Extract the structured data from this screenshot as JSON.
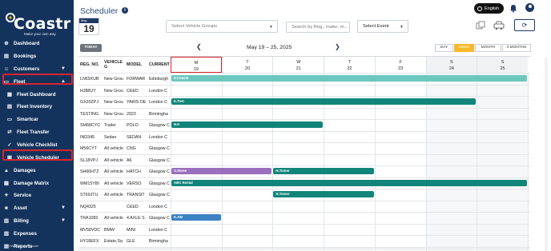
{
  "app": {
    "logo": "Coastr",
    "tagline": "Make your own way",
    "page_title": "Scheduler",
    "powered_by": "POWERED BY Coastr"
  },
  "header": {
    "language": "English"
  },
  "sidebar": {
    "items": [
      {
        "label": "Dashboard",
        "icon": "dashboard-icon"
      },
      {
        "label": "Bookings",
        "icon": "bookings-icon"
      },
      {
        "label": "Customers",
        "icon": "customers-icon",
        "chevron": "down"
      },
      {
        "label": "Fleet",
        "icon": "fleet-icon",
        "chevron": "up"
      },
      {
        "label": "Fleet Dashboard",
        "icon": "fleet-dashboard-icon"
      },
      {
        "label": "Fleet Inventory",
        "icon": "fleet-inventory-icon"
      },
      {
        "label": "Smartcar",
        "icon": "smartcar-icon"
      },
      {
        "label": "Fleet Transfer",
        "icon": "fleet-transfer-icon"
      },
      {
        "label": "Vehicle Checklist",
        "icon": "checklist-icon"
      },
      {
        "label": "Vehicle Scheduler",
        "icon": "scheduler-icon"
      },
      {
        "label": "Damages",
        "icon": "damages-icon"
      },
      {
        "label": "Damage Matrix",
        "icon": "damage-matrix-icon"
      },
      {
        "label": "Service",
        "icon": "service-icon"
      },
      {
        "label": "Asset",
        "icon": "asset-icon",
        "chevron": "down"
      },
      {
        "label": "Billing",
        "icon": "billing-icon",
        "chevron": "down"
      },
      {
        "label": "Expenses",
        "icon": "expenses-icon"
      },
      {
        "label": "Reports",
        "icon": "reports-icon"
      }
    ]
  },
  "toolbar": {
    "date_month": "May",
    "date_day": "19",
    "vehicle_groups_placeholder": "Select Vehicle Groups",
    "search_placeholder": "Search by Reg., make, m...",
    "event_select": "Select Event"
  },
  "calendar": {
    "today_label": "TODAY",
    "range": "May 19 – 25, 2025",
    "views": [
      "DAY",
      "WEEK",
      "MONTH",
      "3 MONTHS"
    ],
    "active_view": "WEEK",
    "days": [
      {
        "dow": "M",
        "date": "19"
      },
      {
        "dow": "T",
        "date": "20"
      },
      {
        "dow": "W",
        "date": "21"
      },
      {
        "dow": "T",
        "date": "22"
      },
      {
        "dow": "F",
        "date": "23"
      },
      {
        "dow": "S",
        "date": "24"
      },
      {
        "dow": "S",
        "date": "25"
      }
    ]
  },
  "table": {
    "columns": [
      "REG. NO.",
      "VEHICLE G",
      "MODEL",
      "CURRENT"
    ],
    "rows": [
      [
        "LN69XUB",
        "New Grou",
        "FORWAR",
        "Edinburgh"
      ],
      [
        "HJ88UY",
        "New Grou",
        "CEED",
        "London C"
      ],
      [
        "GX20ZPJ",
        "New Grou",
        "YARIS DE",
        "London C"
      ],
      [
        "TESTING",
        "New Grou",
        "2023",
        "Birmingha"
      ],
      [
        "SM68CYC",
        "Trailer",
        "POLO",
        "Glasgow C"
      ],
      [
        "IND345",
        "Sedan",
        "SEDAN",
        "London C"
      ],
      [
        "M56CYT",
        "All vehicle",
        "CNG",
        "Glasgow C"
      ],
      [
        "SL18VPJ",
        "All vehicle",
        "A6",
        "Glasgow C"
      ],
      [
        "SH60HTZ",
        "All vehicle",
        "HATCH",
        "Glasgow C"
      ],
      [
        "WM15YBI",
        "All vehicle",
        "VERSO",
        "Glasgow C"
      ],
      [
        "ST69JTU",
        "All vehicle",
        "TRANSIT",
        "Glasgow C"
      ],
      [
        "NQ4325",
        "",
        "CEED",
        "London C"
      ],
      [
        "TRA1082",
        "All vehicle",
        "4 AXLE S",
        "Glasgow C"
      ],
      [
        "MV58VDC",
        "BMW",
        "MINI",
        "London C"
      ],
      [
        "HY18EFX",
        "Estate,Sq",
        "GLE",
        "Birmingha"
      ],
      [
        "FK12ABC",
        "New Grou",
        "SEDAN",
        "Glasgow C"
      ]
    ]
  },
  "events": [
    {
      "row": 0,
      "label": "E.Coasts",
      "color": "#6cc7bf",
      "start": 0,
      "end": 7
    },
    {
      "row": 2,
      "label": "K.Test",
      "color": "#12857a",
      "start": 0,
      "end": 6
    },
    {
      "row": 4,
      "label": "N.K",
      "color": "#12857a",
      "start": 0,
      "end": 3
    },
    {
      "row": 8,
      "label": "S.Stone",
      "color": "#9b6fbf",
      "start": 0,
      "end": 2
    },
    {
      "row": 8,
      "label": "N.Tomer",
      "color": "#12857a",
      "start": 2,
      "end": 4
    },
    {
      "row": 9,
      "label": "ABC Rental",
      "color": "#12857a",
      "start": 0,
      "end": 7
    },
    {
      "row": 10,
      "label": "N.Tomer",
      "color": "#12857a",
      "start": 2,
      "end": 4
    },
    {
      "row": 12,
      "label": "K.AM",
      "color": "#3b82c4",
      "start": 0,
      "end": 1
    }
  ]
}
